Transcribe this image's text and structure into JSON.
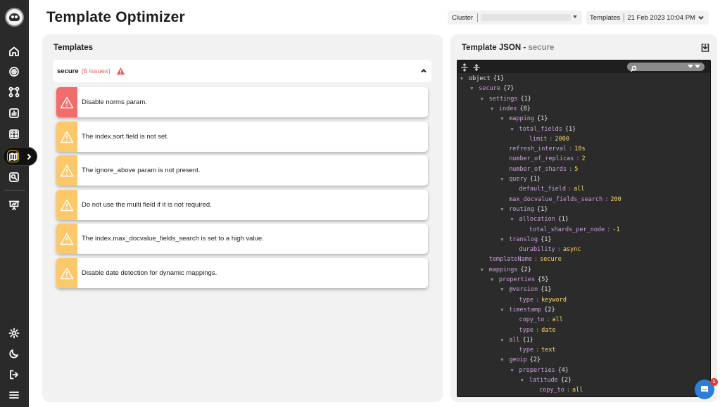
{
  "header": {
    "title": "Template Optimizer",
    "cluster_label": "Cluster",
    "templates_label": "Templates",
    "timestamp": "21 Feb 2023 10:04 PM"
  },
  "sidebar": {
    "items": [
      {
        "name": "home-icon"
      },
      {
        "name": "target-icon"
      },
      {
        "name": "nodes-icon"
      },
      {
        "name": "bar-chart-icon"
      },
      {
        "name": "grid-icon"
      },
      {
        "name": "map-icon",
        "active": true
      },
      {
        "name": "search-report-icon"
      },
      {
        "name": "presentation-icon"
      }
    ],
    "bottom": [
      {
        "name": "settings-icon"
      },
      {
        "name": "moon-icon"
      },
      {
        "name": "logout-icon"
      },
      {
        "name": "menu-icon"
      }
    ]
  },
  "templates_panel": {
    "title": "Templates",
    "template_name": "secure",
    "issues_label": "(6 issues)",
    "issues": [
      {
        "text": "Disable norms param.",
        "severity": "high",
        "color": "#f16c6a"
      },
      {
        "text": "The index.sort.field is not set.",
        "severity": "medium",
        "color": "#fcc86a"
      },
      {
        "text": "The ignore_above param is not present.",
        "severity": "medium",
        "color": "#fcc86a"
      },
      {
        "text": "Do not use the multi field if it is not required.",
        "severity": "medium",
        "color": "#fcc86a"
      },
      {
        "text": "The index.max_docvalue_fields_search is set to a high value.",
        "severity": "medium",
        "color": "#fcc86a"
      },
      {
        "text": "Disable date detection for dynamic mappings.",
        "severity": "medium",
        "color": "#fcc86a"
      }
    ]
  },
  "json_panel": {
    "title_prefix": "Template JSON -",
    "template_name": "secure",
    "tree": [
      {
        "depth": 0,
        "key": "object",
        "count": "{1}",
        "root": true
      },
      {
        "depth": 1,
        "key": "secure",
        "count": "{7}"
      },
      {
        "depth": 2,
        "key": "settings",
        "count": "{1}"
      },
      {
        "depth": 3,
        "key": "index",
        "count": "{8}"
      },
      {
        "depth": 4,
        "key": "mapping",
        "count": "{1}"
      },
      {
        "depth": 5,
        "key": "total_fields",
        "count": "{1}"
      },
      {
        "depth": 6,
        "key": "limit",
        "value": "2000",
        "leaf": true
      },
      {
        "depth": 4,
        "key": "refresh_interval",
        "value": "10s",
        "leaf": true
      },
      {
        "depth": 4,
        "key": "number_of_replicas",
        "value": "2",
        "leaf": true
      },
      {
        "depth": 4,
        "key": "number_of_shards",
        "value": "5",
        "leaf": true
      },
      {
        "depth": 4,
        "key": "query",
        "count": "{1}"
      },
      {
        "depth": 5,
        "key": "default_field",
        "value": "all",
        "leaf": true
      },
      {
        "depth": 4,
        "key": "max_docvalue_fields_search",
        "value": "200",
        "leaf": true
      },
      {
        "depth": 4,
        "key": "routing",
        "count": "{1}"
      },
      {
        "depth": 5,
        "key": "allocation",
        "count": "{1}"
      },
      {
        "depth": 6,
        "key": "total_shards_per_node",
        "value": "-1",
        "leaf": true
      },
      {
        "depth": 4,
        "key": "translog",
        "count": "{1}"
      },
      {
        "depth": 5,
        "key": "durability",
        "value": "async",
        "leaf": true
      },
      {
        "depth": 2,
        "key": "templateName",
        "value": "secure",
        "leaf": true
      },
      {
        "depth": 2,
        "key": "mappings",
        "count": "{2}"
      },
      {
        "depth": 3,
        "key": "properties",
        "count": "{5}"
      },
      {
        "depth": 4,
        "key": "@version",
        "count": "{1}"
      },
      {
        "depth": 5,
        "key": "type",
        "value": "keyword",
        "leaf": true
      },
      {
        "depth": 4,
        "key": "timestamp",
        "count": "{2}"
      },
      {
        "depth": 5,
        "key": "copy_to",
        "value": "all",
        "leaf": true
      },
      {
        "depth": 5,
        "key": "type",
        "value": "date",
        "leaf": true
      },
      {
        "depth": 4,
        "key": "all",
        "count": "{1}"
      },
      {
        "depth": 5,
        "key": "type",
        "value": "text",
        "leaf": true
      },
      {
        "depth": 4,
        "key": "geoip",
        "count": "{2}"
      },
      {
        "depth": 5,
        "key": "properties",
        "count": "{4}"
      },
      {
        "depth": 6,
        "key": "latitude",
        "count": "{2}"
      },
      {
        "depth": 7,
        "key": "copy_to",
        "value": "all",
        "leaf": true
      }
    ]
  },
  "chat": {
    "badge": "1",
    "color": "#2e7dd8"
  }
}
